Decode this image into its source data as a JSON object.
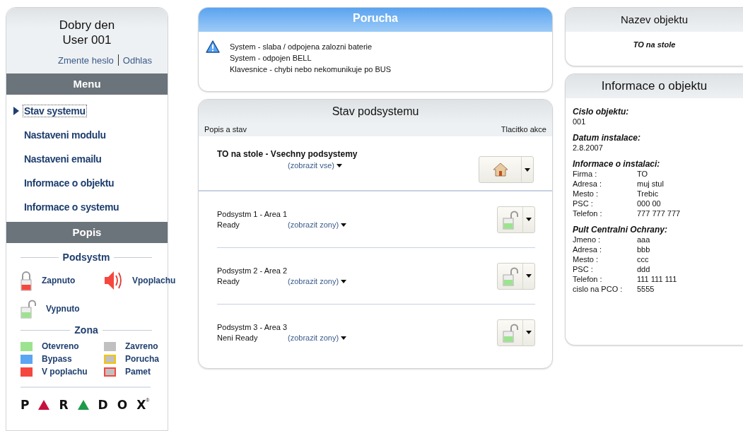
{
  "user_panel": {
    "greeting": "Dobry den",
    "user": "User 001",
    "links": [
      {
        "label": "Zmente heslo"
      },
      {
        "label": "Odhlas"
      }
    ]
  },
  "menu": {
    "title": "Menu",
    "items": [
      {
        "label": "Stav systemu",
        "selected": true
      },
      {
        "label": "Nastaveni modulu",
        "selected": false
      },
      {
        "label": "Nastaveni emailu",
        "selected": false
      },
      {
        "label": "Informace o objektu",
        "selected": false
      },
      {
        "label": "Informace o systemu",
        "selected": false
      }
    ]
  },
  "legend": {
    "title": "Popis",
    "subsystem_title": "Podsystm",
    "subsystem_items": [
      {
        "kind": "locked",
        "label": "Zapnuto"
      },
      {
        "kind": "alarm",
        "label": "Vpoplachu"
      },
      {
        "kind": "unlocked",
        "label": "Vypnuto"
      }
    ],
    "zone_title": "Zona",
    "zone_items": [
      {
        "label": "Otevreno",
        "kind": "fill",
        "color": "#9ce38f"
      },
      {
        "label": "Zavreno",
        "kind": "fill",
        "color": "#c0c0c0"
      },
      {
        "label": "Bypass",
        "kind": "fill",
        "color": "#5aa6f2"
      },
      {
        "label": "Porucha",
        "kind": "outline",
        "color": "#f5c400"
      },
      {
        "label": "V poplachu",
        "kind": "fill",
        "color": "#f5473f"
      },
      {
        "label": "Pamet",
        "kind": "outline",
        "color": "#f5473f"
      }
    ]
  },
  "logo": {
    "marks": [
      {
        "kind": "letter",
        "text": "P"
      },
      {
        "kind": "triangle",
        "color": "#c8103e"
      },
      {
        "kind": "letter",
        "text": "R"
      },
      {
        "kind": "triangle",
        "color": "#1e9a48"
      },
      {
        "kind": "letter",
        "text": "D"
      },
      {
        "kind": "letter",
        "text": "O"
      },
      {
        "kind": "letter",
        "text": "X"
      }
    ],
    "registered": "®"
  },
  "trouble": {
    "title": "Porucha",
    "messages": [
      "System - slaba / odpojena zalozni baterie",
      "System - odpojen BELL",
      "Klavesnice - chybi nebo nekomunikuje po BUS"
    ]
  },
  "subsystems": {
    "title": "Stav podsystemu",
    "column_1": "Popis a stav",
    "column_2": "Tlacitko akce",
    "all": {
      "name": "TO na stole - Vsechny podsystemy",
      "link": "(zobrazit vse)",
      "kind": "home"
    },
    "areas": [
      {
        "name": "Podsystm 1 - Area 1",
        "status": "Ready",
        "link": "(zobrazit zony)",
        "armed": false
      },
      {
        "name": "Podsystm 2 - Area 2",
        "status": "Ready",
        "link": "(zobrazit zony)",
        "armed": false
      },
      {
        "name": "Podsystm 3 - Area 3",
        "status": "Neni Ready",
        "link": "(zobrazit zony)",
        "armed": false
      }
    ]
  },
  "object_name": {
    "title": "Nazev objektu",
    "value": "TO na stole"
  },
  "object_info": {
    "title": "Informace o objektu",
    "sections": [
      {
        "heading": "Cislo objektu:",
        "value": "001"
      },
      {
        "heading": "Datum instalace:",
        "value": "2.8.2007"
      },
      {
        "heading": "Informace o instalaci:",
        "rows": [
          {
            "label": "Firma :",
            "value": "TO"
          },
          {
            "label": "Adresa :",
            "value": "muj stul"
          },
          {
            "label": "Mesto :",
            "value": "Trebic"
          },
          {
            "label": "PSC :",
            "value": "000 00"
          },
          {
            "label": "Telefon :",
            "value": "777 777 777"
          }
        ]
      },
      {
        "heading": "Pult Centralni Ochrany:",
        "rows": [
          {
            "label": "Jmeno :",
            "value": "aaa"
          },
          {
            "label": "Adresa :",
            "value": "bbb"
          },
          {
            "label": "Mesto :",
            "value": "ccc"
          },
          {
            "label": "PSC :",
            "value": "ddd"
          },
          {
            "label": "Telefon :",
            "value": "111 111 111"
          },
          {
            "label": "cislo na PCO :",
            "value": "5555"
          }
        ]
      }
    ]
  }
}
